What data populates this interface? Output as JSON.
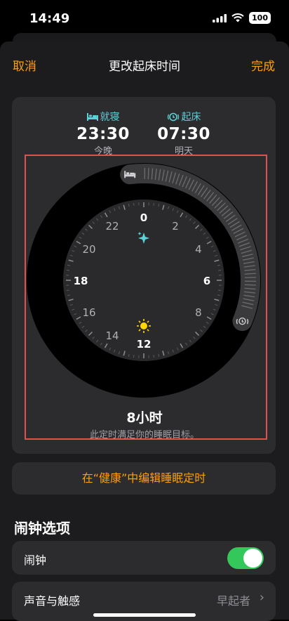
{
  "status": {
    "time": "14:49",
    "battery": "100"
  },
  "nav": {
    "cancel": "取消",
    "title": "更改起床时间",
    "done": "完成"
  },
  "bedtime": {
    "icon": "bed-icon",
    "label": "就寝",
    "time": "23:30",
    "day": "今晚"
  },
  "wake": {
    "icon": "alarm-icon",
    "label": "起床",
    "time": "07:30",
    "day": "明天"
  },
  "clock": {
    "numbers": [
      "0",
      "2",
      "4",
      "6",
      "8",
      "12",
      "14",
      "16",
      "18",
      "20",
      "22"
    ],
    "sleep_start_hour": 23.5,
    "sleep_end_hour": 7.5,
    "night_icon": "sparkle-icon",
    "day_icon": "sun-icon"
  },
  "duration": "8小时",
  "goal_text": "此定时满足你的睡眠目标。",
  "edit_link": "在“健康”中编辑睡眠定时",
  "section_title": "闹钟选项",
  "alarm_row": {
    "label": "闹钟",
    "on": true
  },
  "sound_row": {
    "label": "声音与触感",
    "value": "早起者"
  },
  "colors": {
    "accent": "#ff9f0a",
    "teal": "#5ad2d8",
    "toggle": "#34c759",
    "highlight": "#e0514b"
  }
}
